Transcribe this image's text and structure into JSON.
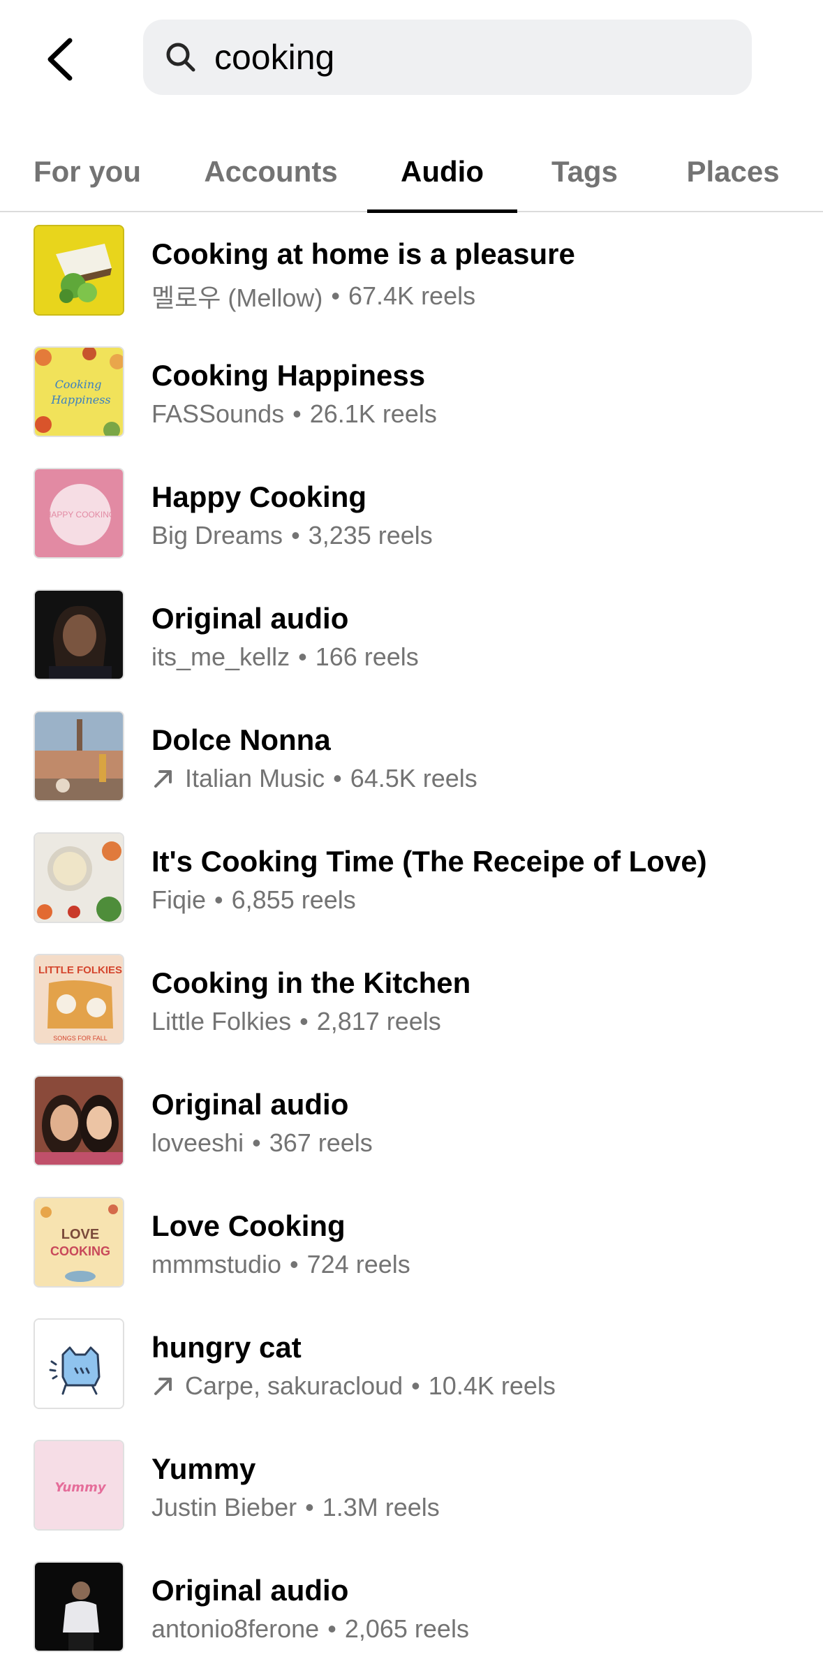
{
  "search": {
    "query": "cooking"
  },
  "tabs": [
    {
      "label": "For you"
    },
    {
      "label": "Accounts"
    },
    {
      "label": "Audio"
    },
    {
      "label": "Tags"
    },
    {
      "label": "Places"
    }
  ],
  "active_tab": "Audio",
  "results": [
    {
      "title": "Cooking at home is a pleasure",
      "artist": "멜로우 (Mellow)",
      "reels": "67.4K reels",
      "trending": false
    },
    {
      "title": "Cooking Happiness",
      "artist": "FASSounds",
      "reels": "26.1K reels",
      "trending": false
    },
    {
      "title": "Happy Cooking",
      "artist": "Big Dreams",
      "reels": "3,235 reels",
      "trending": false
    },
    {
      "title": "Original audio",
      "artist": "its_me_kellz",
      "reels": "166 reels",
      "trending": false
    },
    {
      "title": "Dolce Nonna",
      "artist": "Italian Music",
      "reels": "64.5K reels",
      "trending": true
    },
    {
      "title": "It's Cooking Time (The Receipe of Love)",
      "artist": "Fiqie",
      "reels": "6,855 reels",
      "trending": false
    },
    {
      "title": "Cooking in the Kitchen",
      "artist": "Little Folkies",
      "reels": "2,817 reels",
      "trending": false
    },
    {
      "title": "Original audio",
      "artist": "loveeshi",
      "reels": "367 reels",
      "trending": false
    },
    {
      "title": "Love Cooking",
      "artist": "mmmstudio",
      "reels": "724 reels",
      "trending": false
    },
    {
      "title": "hungry cat",
      "artist": "Carpe, sakuracloud",
      "reels": "10.4K reels",
      "trending": true
    },
    {
      "title": "Yummy",
      "artist": "Justin Bieber",
      "reels": "1.3M reels",
      "trending": false
    },
    {
      "title": "Original audio",
      "artist": "antonio8ferone",
      "reels": "2,065 reels",
      "trending": false
    }
  ],
  "thumbnail_art": {
    "cooking_happiness": "Cooking Happiness",
    "happy_cooking": "HAPPY COOKING",
    "little_folkies": "LITTLE FOLKIES",
    "little_folkies_sub": "SONGS FOR FALL",
    "love_cooking": "LOVE COOKING",
    "yummy": "Yummy"
  },
  "separator": "•",
  "colors": {
    "accent": "#000000",
    "muted": "#737373",
    "search_bg": "#eff0f2",
    "divider": "#dbdbdb"
  }
}
